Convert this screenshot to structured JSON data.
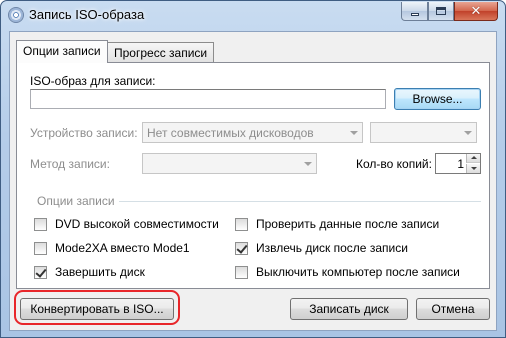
{
  "window": {
    "title": "Запись ISO-образа",
    "controls": {
      "minimize": "minimize",
      "maximize": "maximize",
      "close": "close"
    }
  },
  "tabs": [
    {
      "label": "Опции записи",
      "active": true
    },
    {
      "label": "Прогресс записи",
      "active": false
    }
  ],
  "iso": {
    "label": "ISO-образ для записи:",
    "value": "",
    "browse_label": "Browse..."
  },
  "device": {
    "label": "Устройство записи:",
    "selected": "Нет совместимых дисководов",
    "secondary_selected": "",
    "enabled": false
  },
  "method": {
    "label": "Метод записи:",
    "selected": "",
    "enabled": false
  },
  "copies": {
    "label": "Кол-во копий:",
    "value": "1"
  },
  "options": {
    "group_label": "Опции записи",
    "left": [
      {
        "label": "DVD высокой совместимости",
        "checked": false
      },
      {
        "label": "Mode2XA вместо Mode1",
        "checked": false
      },
      {
        "label": "Завершить диск",
        "checked": true
      }
    ],
    "right": [
      {
        "label": "Проверить данные после записи",
        "checked": false
      },
      {
        "label": "Извлечь диск после записи",
        "checked": true
      },
      {
        "label": "Выключить компьютер после записи",
        "checked": false
      }
    ]
  },
  "footer": {
    "convert_label": "Конвертировать в ISO...",
    "burn_label": "Записать диск",
    "cancel_label": "Отмена"
  },
  "colors": {
    "highlight": "#e8262a",
    "window_frame": "#b5cde9",
    "client_bg": "#f0f0f0"
  }
}
